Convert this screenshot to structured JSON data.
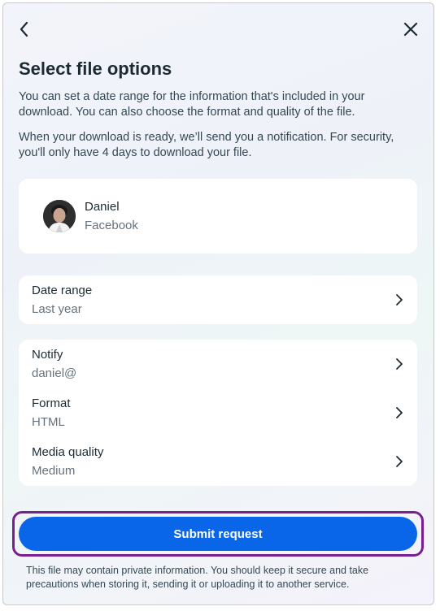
{
  "header": {
    "back_icon": "chevron-left-icon",
    "close_icon": "close-icon",
    "title": "Select file options"
  },
  "intro": {
    "paragraph1": "You can set a date range for the information that's included in your download. You can also choose the format and quality of the file.",
    "paragraph2": "When your download is ready, we’ll send you a notification. For security, you'll only have 4 days to download your file."
  },
  "profile": {
    "name": "Daniel",
    "platform": "Facebook",
    "avatar_icon": "avatar-photo"
  },
  "date_range": {
    "label": "Date range",
    "value": "Last year"
  },
  "options": [
    {
      "label": "Notify",
      "value": "daniel@"
    },
    {
      "label": "Format",
      "value": "HTML"
    },
    {
      "label": "Media quality",
      "value": "Medium"
    }
  ],
  "submit": {
    "label": "Submit request",
    "color": "#0a66e8",
    "highlight_color": "#7a1f8f"
  },
  "disclaimer": "This file may contain private information. You should keep it secure and take precautions when storing it, sending it or uploading it to another service."
}
